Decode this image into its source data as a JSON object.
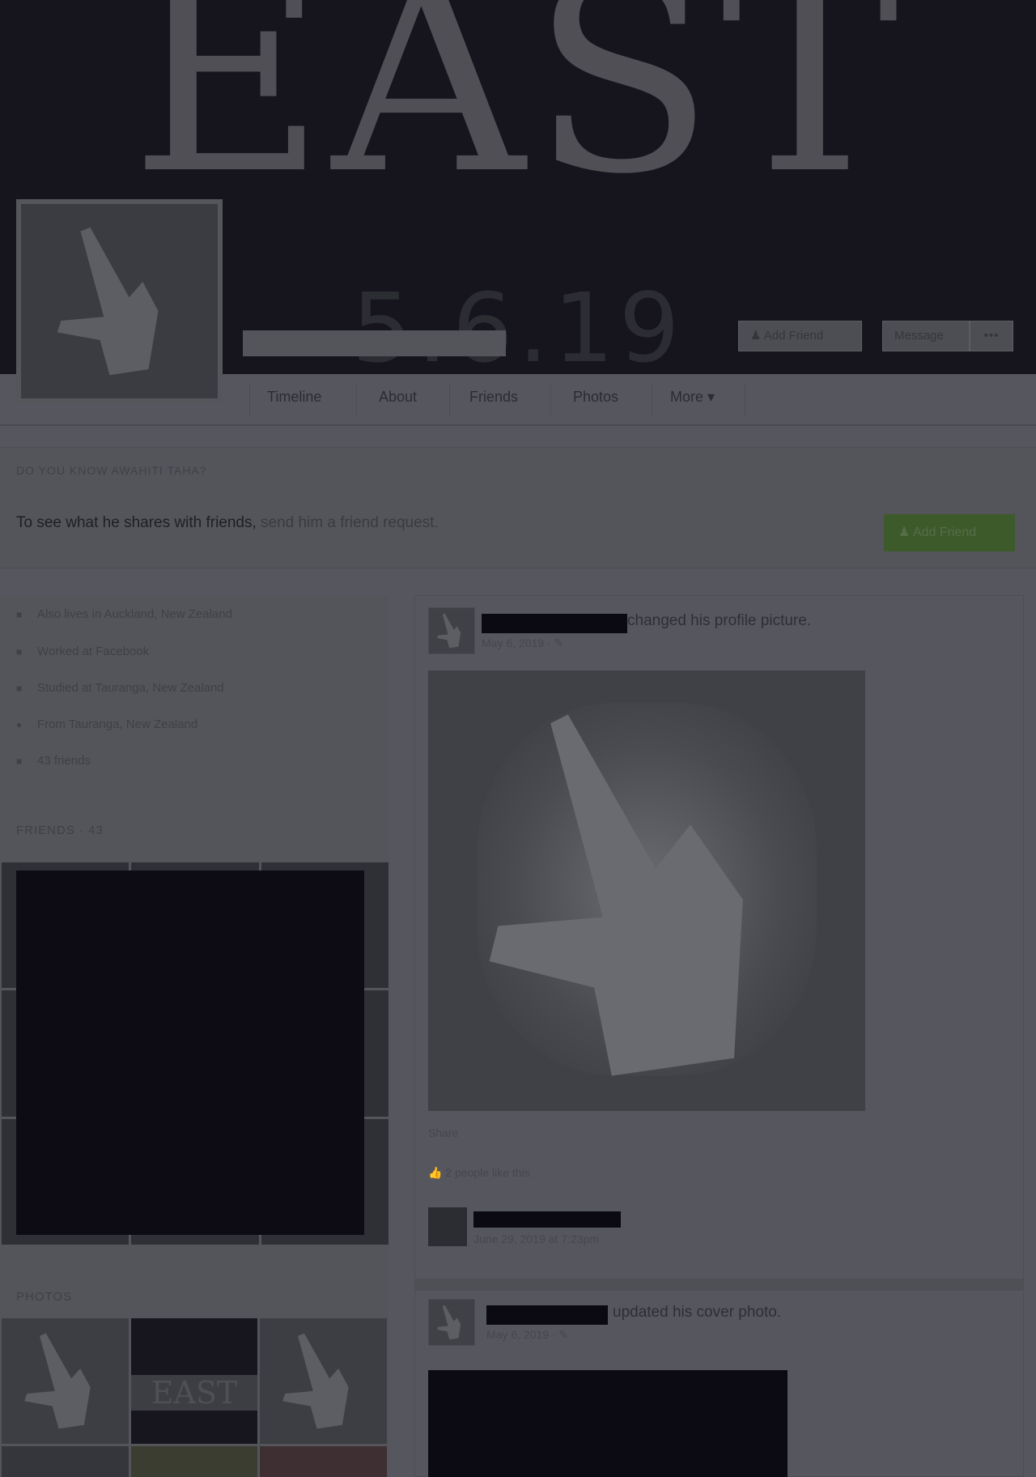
{
  "cover": {
    "title": "EAST",
    "date": "5.6.19"
  },
  "header_buttons": {
    "add_friend": "Add Friend",
    "message": "Message",
    "more": "•••"
  },
  "tabs": [
    {
      "label": "Timeline"
    },
    {
      "label": "About"
    },
    {
      "label": "Friends"
    },
    {
      "label": "Photos"
    },
    {
      "label": "More ▾"
    }
  ],
  "friend_request": {
    "heading": "DO YOU KNOW AWAHITI TAHA?",
    "text_bold": "To see what he shares with friends,",
    "text_light": "send him a friend request.",
    "button": "Add Friend"
  },
  "about": [
    {
      "icon": "briefcase-icon",
      "glyph": "■",
      "text": "Also lives in Auckland, New Zealand"
    },
    {
      "icon": "work-icon",
      "glyph": "■",
      "text": "Worked at Facebook"
    },
    {
      "icon": "school-icon",
      "glyph": "■",
      "text": "Studied at Tauranga, New Zealand"
    },
    {
      "icon": "location-icon",
      "glyph": "●",
      "text": "From Tauranga, New Zealand"
    },
    {
      "icon": "friends-icon",
      "glyph": "■",
      "text": "43 friends"
    }
  ],
  "sections": {
    "friends": "FRIENDS · 43",
    "photos": "PHOTOS"
  },
  "posts": {
    "p1": {
      "action": "changed his profile picture.",
      "date": "May 6, 2019 · ✎",
      "share": "Share",
      "likes": "2 people like this.",
      "comment_date": "June 29, 2019 at 7:23pm"
    },
    "p2": {
      "action": "updated his cover photo.",
      "date": "May 6, 2019 · ✎"
    }
  }
}
